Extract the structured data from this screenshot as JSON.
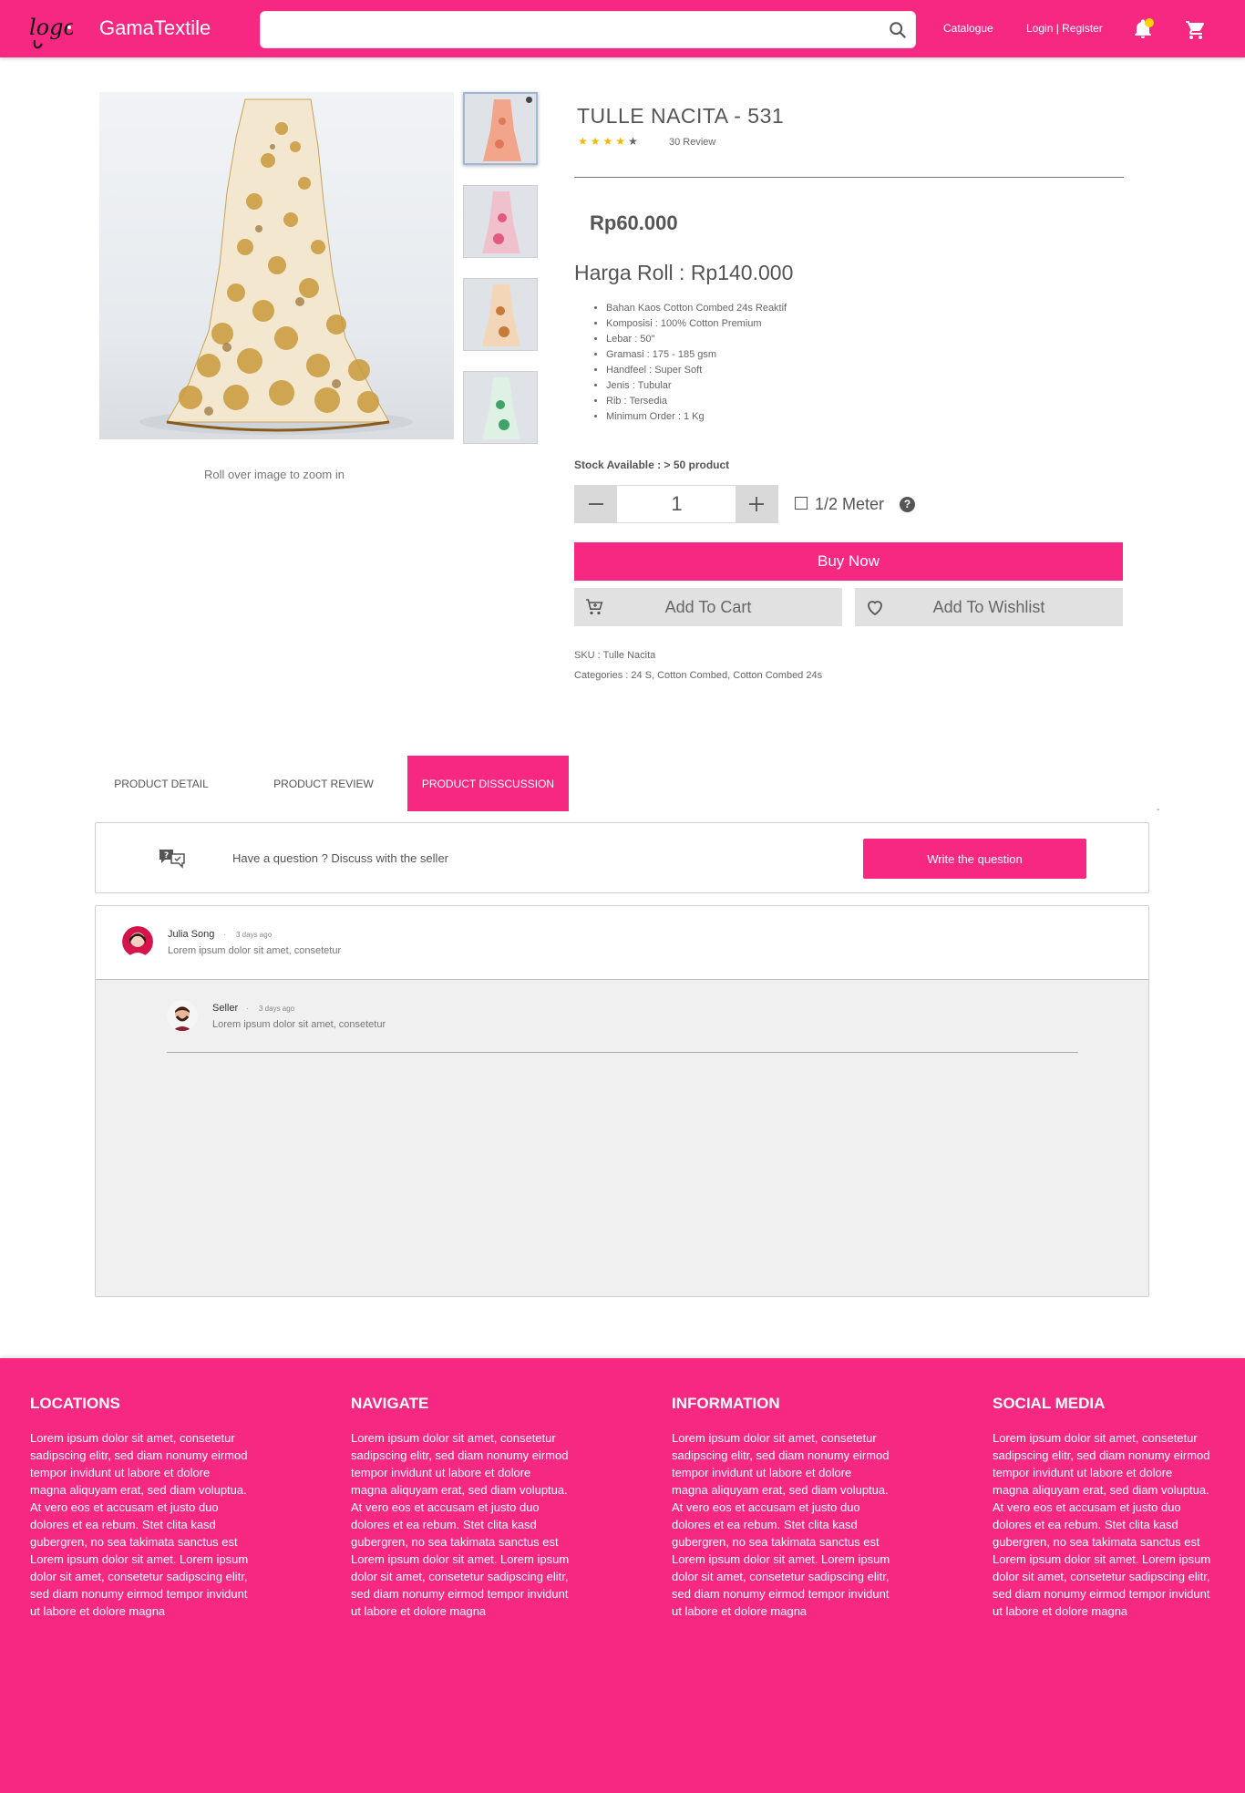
{
  "header": {
    "logo_text": "logo",
    "brand": "GamaTextile",
    "search_placeholder": "",
    "nav_catalogue": "Catalogue",
    "nav_login_register": "Login | Register"
  },
  "product": {
    "title": "TULLE NACITA - 531",
    "rating": 4,
    "rating_max": 5,
    "review_count": "30 Review",
    "price": "Rp60.000",
    "harga_roll": "Harga Roll : Rp140.000",
    "specs": [
      "Bahan Kaos Cotton Combed 24s Reaktif",
      "Komposisi : 100% Cotton Premium",
      "Lebar : 50\"",
      "Gramasi : 175 - 185 gsm",
      "Handfeel : Super Soft",
      "Jenis : Tubular",
      "Rib : Tersedia",
      "Minimum Order : 1 Kg"
    ],
    "stock": "Stock Available : > 50 product",
    "quantity": "1",
    "half_meter_label": "1/2 Meter",
    "buy_now": "Buy Now",
    "add_to_cart": "Add To Cart",
    "add_to_wishlist": "Add To Wishlist",
    "sku": "SKU : Tulle Nacita",
    "categories": "Categories :  24 S, Cotton Combed, Cotton Combed 24s",
    "zoom_hint": "Roll over image to zoom in"
  },
  "tabs": [
    {
      "label": "PRODUCT DETAIL"
    },
    {
      "label": "PRODUCT REVIEW"
    },
    {
      "label": "PRODUCT DISSCUSSION"
    }
  ],
  "discussion": {
    "prompt": "Have a question ? Discuss with the seller",
    "write_button": "Write the question",
    "comment": {
      "name": "Julia Song",
      "time": "3 days ago",
      "text": "Lorem ipsum dolor sit amet, consetetur"
    },
    "reply": {
      "name": "Seller",
      "time": "3 days ago",
      "text": "Lorem ipsum dolor sit amet, consetetur"
    }
  },
  "footer": {
    "columns": [
      {
        "heading": "LOCATIONS",
        "text": "Lorem ipsum dolor sit amet, consetetur sadipscing elitr, sed diam nonumy eirmod tempor invidunt ut labore et dolore magna aliquyam erat, sed diam voluptua. At vero eos et accusam et justo duo dolores et ea rebum. Stet clita kasd gubergren, no sea takimata sanctus est Lorem ipsum dolor sit amet. Lorem ipsum dolor sit amet, consetetur sadipscing elitr, sed diam nonumy eirmod tempor invidunt ut labore et dolore magna"
      },
      {
        "heading": "NAVIGATE",
        "text": "Lorem ipsum dolor sit amet, consetetur sadipscing elitr, sed diam nonumy eirmod tempor invidunt ut labore et dolore magna aliquyam erat, sed diam voluptua. At vero eos et accusam et justo duo dolores et ea rebum. Stet clita kasd gubergren, no sea takimata sanctus est Lorem ipsum dolor sit amet. Lorem ipsum dolor sit amet, consetetur sadipscing elitr, sed diam nonumy eirmod tempor invidunt ut labore et dolore magna"
      },
      {
        "heading": "INFORMATION",
        "text": "Lorem ipsum dolor sit amet, consetetur sadipscing elitr, sed diam nonumy eirmod tempor invidunt ut labore et dolore magna aliquyam erat, sed diam voluptua. At vero eos et accusam et justo duo dolores et ea rebum. Stet clita kasd gubergren, no sea takimata sanctus est Lorem ipsum dolor sit amet. Lorem ipsum dolor sit amet, consetetur sadipscing elitr, sed diam nonumy eirmod tempor invidunt ut labore et dolore magna"
      },
      {
        "heading": "SOCIAL MEDIA",
        "text": "Lorem ipsum dolor sit amet, consetetur sadipscing elitr, sed diam nonumy eirmod tempor invidunt ut labore et dolore magna aliquyam erat, sed diam voluptua. At vero eos et accusam et justo duo dolores et ea rebum. Stet clita kasd gubergren, no sea takimata sanctus est Lorem ipsum dolor sit amet. Lorem ipsum dolor sit amet, consetetur sadipscing elitr, sed diam nonumy eirmod tempor invidunt ut labore et dolore magna"
      }
    ]
  },
  "colors": {
    "brand": "#f72882",
    "star": "#f5b800",
    "star_empty": "#666666",
    "notification": "#ffd200",
    "button_grey": "#e1e1e1"
  },
  "icons": [
    "logo",
    "search-icon",
    "bell-icon",
    "cart-icon",
    "minus-icon",
    "plus-icon",
    "checkbox-icon",
    "help-icon",
    "cart-add-icon",
    "heart-icon",
    "chat-icon",
    "avatar"
  ]
}
